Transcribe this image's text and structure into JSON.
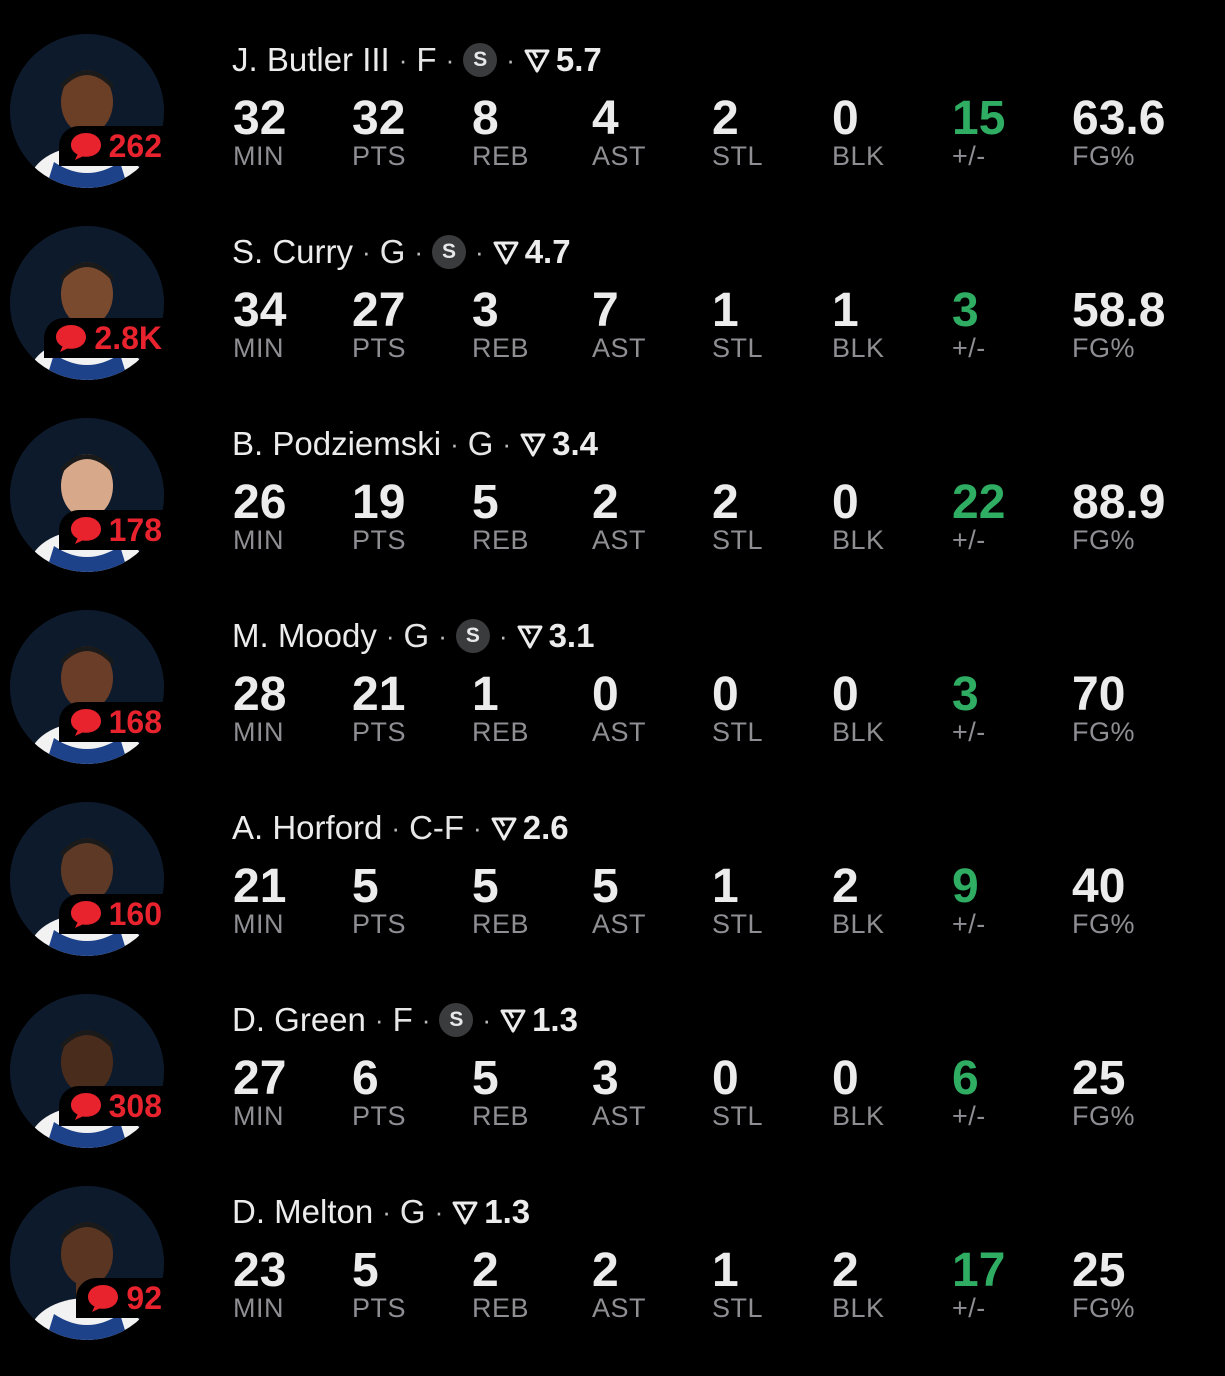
{
  "colors": {
    "background": "#000000",
    "comment_red": "#e8232e",
    "plus_minus_green": "#2fae63",
    "label_gray": "#8e8e93"
  },
  "icons": {
    "comment": "speech-bubble-icon",
    "starter": "starter-badge-icon",
    "rating": "rating-flag-icon"
  },
  "labels": {
    "min": "MIN",
    "pts": "PTS",
    "reb": "REB",
    "ast": "AST",
    "stl": "STL",
    "blk": "BLK",
    "pm": "+/-",
    "fg": "FG%"
  },
  "players": [
    {
      "name": "J. Butler III",
      "pos": "F",
      "starter": true,
      "starter_label": "S",
      "rating": "5.7",
      "comments": "262",
      "min": "32",
      "pts": "32",
      "reb": "8",
      "ast": "4",
      "stl": "2",
      "blk": "0",
      "pm": "15",
      "fg": "63.6"
    },
    {
      "name": "S. Curry",
      "pos": "G",
      "starter": true,
      "starter_label": "S",
      "rating": "4.7",
      "comments": "2.8K",
      "min": "34",
      "pts": "27",
      "reb": "3",
      "ast": "7",
      "stl": "1",
      "blk": "1",
      "pm": "3",
      "fg": "58.8"
    },
    {
      "name": "B. Podziemski",
      "pos": "G",
      "starter": false,
      "starter_label": "",
      "rating": "3.4",
      "comments": "178",
      "min": "26",
      "pts": "19",
      "reb": "5",
      "ast": "2",
      "stl": "2",
      "blk": "0",
      "pm": "22",
      "fg": "88.9"
    },
    {
      "name": "M. Moody",
      "pos": "G",
      "starter": true,
      "starter_label": "S",
      "rating": "3.1",
      "comments": "168",
      "min": "28",
      "pts": "21",
      "reb": "1",
      "ast": "0",
      "stl": "0",
      "blk": "0",
      "pm": "3",
      "fg": "70"
    },
    {
      "name": "A. Horford",
      "pos": "C-F",
      "starter": false,
      "starter_label": "",
      "rating": "2.6",
      "comments": "160",
      "min": "21",
      "pts": "5",
      "reb": "5",
      "ast": "5",
      "stl": "1",
      "blk": "2",
      "pm": "9",
      "fg": "40"
    },
    {
      "name": "D. Green",
      "pos": "F",
      "starter": true,
      "starter_label": "S",
      "rating": "1.3",
      "comments": "308",
      "min": "27",
      "pts": "6",
      "reb": "5",
      "ast": "3",
      "stl": "0",
      "blk": "0",
      "pm": "6",
      "fg": "25"
    },
    {
      "name": "D. Melton",
      "pos": "G",
      "starter": false,
      "starter_label": "",
      "rating": "1.3",
      "comments": "92",
      "min": "23",
      "pts": "5",
      "reb": "2",
      "ast": "2",
      "stl": "1",
      "blk": "2",
      "pm": "17",
      "fg": "25"
    }
  ]
}
